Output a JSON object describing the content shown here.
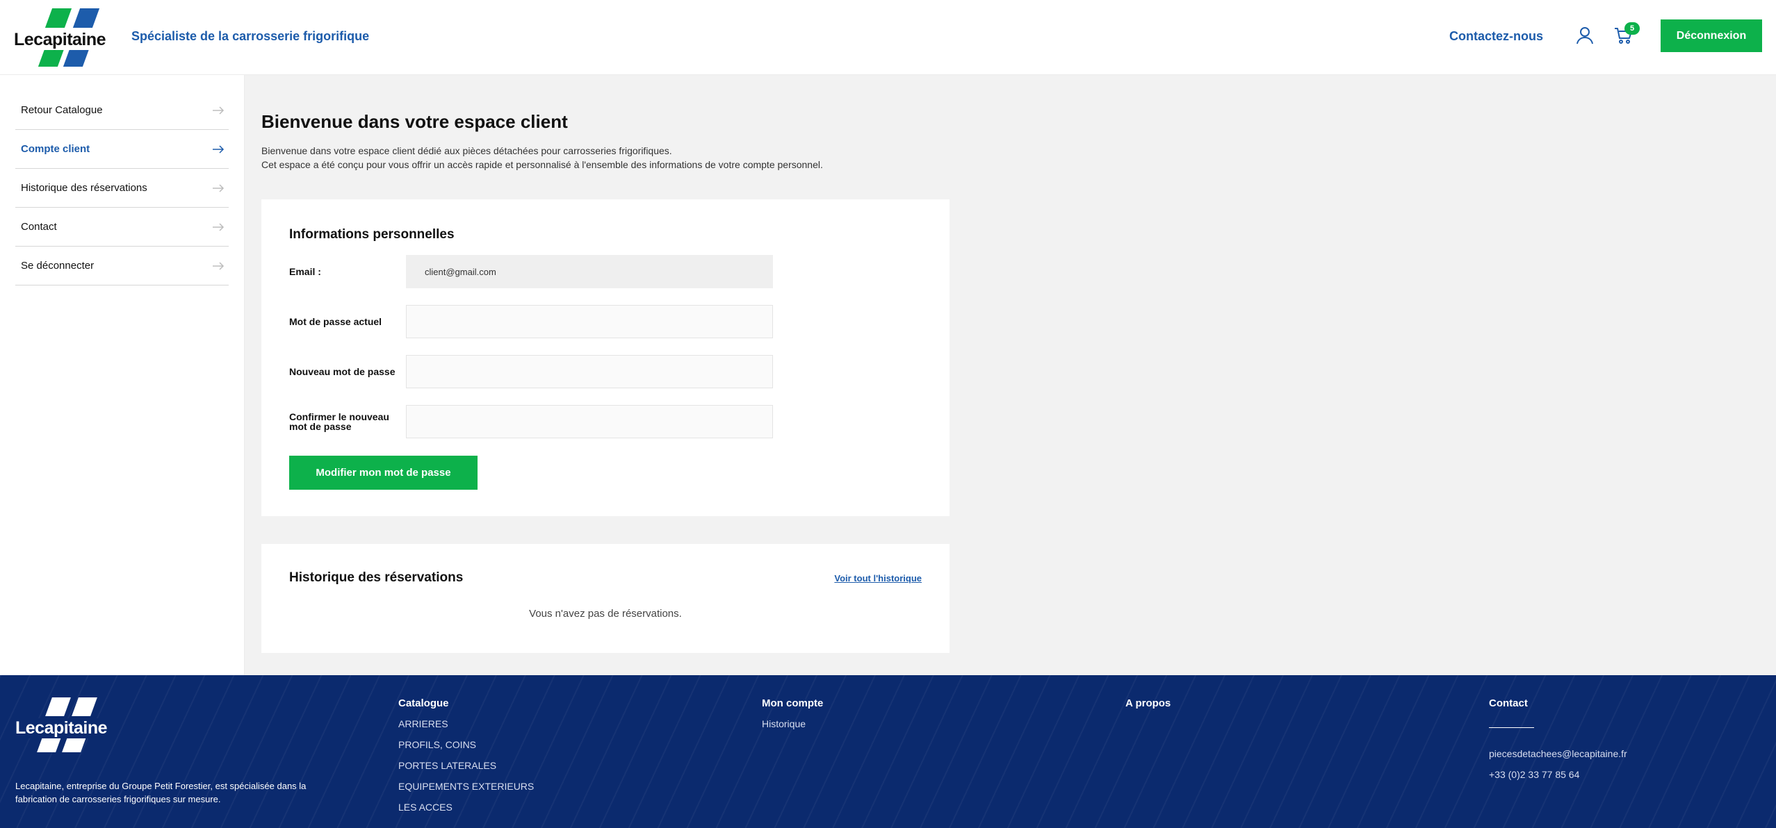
{
  "header": {
    "logo_text": "Lecapitaine",
    "tagline": "Spécialiste de la carrosserie frigorifique",
    "contact_link": "Contactez-nous",
    "cart_count": "5",
    "logout_label": "Déconnexion"
  },
  "sidebar": {
    "items": [
      {
        "label": "Retour Catalogue"
      },
      {
        "label": "Compte client"
      },
      {
        "label": "Historique des réservations"
      },
      {
        "label": "Contact"
      },
      {
        "label": "Se déconnecter"
      }
    ]
  },
  "main": {
    "title": "Bienvenue dans votre espace client",
    "intro_line1": "Bienvenue dans votre espace client dédié aux pièces détachées pour carrosseries frigorifiques.",
    "intro_line2": "Cet espace a été conçu pour vous offrir un accès rapide et personnalisé à l'ensemble des informations de votre compte personnel."
  },
  "personal_info": {
    "title": "Informations personnelles",
    "email_label": "Email :",
    "email_value": "client@gmail.com",
    "current_password_label": "Mot de passe actuel",
    "current_password_value": "",
    "new_password_label": "Nouveau mot de passe",
    "new_password_value": "",
    "confirm_password_label": "Confirmer le nouveau mot de passe",
    "confirm_password_value": "",
    "submit_label": "Modifier mon mot de passe"
  },
  "history": {
    "title": "Historique des réservations",
    "link_label": "Voir tout l'historique",
    "empty_message": "Vous n'avez pas de réservations."
  },
  "footer": {
    "logo_text": "Lecapitaine",
    "description": "Lecapitaine, entreprise du Groupe Petit Forestier, est spécialisée dans la fabrication de carrosseries frigorifiques sur mesure.",
    "catalogue": {
      "title": "Catalogue",
      "items": [
        "ARRIERES",
        "PROFILS, COINS",
        "PORTES LATERALES",
        "EQUIPEMENTS EXTERIEURS",
        "LES ACCES"
      ]
    },
    "mon_compte": {
      "title": "Mon compte",
      "items": [
        "Historique"
      ]
    },
    "a_propos": {
      "title": "A propos"
    },
    "contact": {
      "title": "Contact",
      "email": "piecesdetachees@lecapitaine.fr",
      "phone": "+33 (0)2 33 77 85 64"
    }
  },
  "colors": {
    "brand_blue": "#1d5cab",
    "brand_green": "#0db14b",
    "footer_navy": "#0b2a6e"
  },
  "icons": [
    "user-icon",
    "cart-icon",
    "arrow-right-icon"
  ]
}
